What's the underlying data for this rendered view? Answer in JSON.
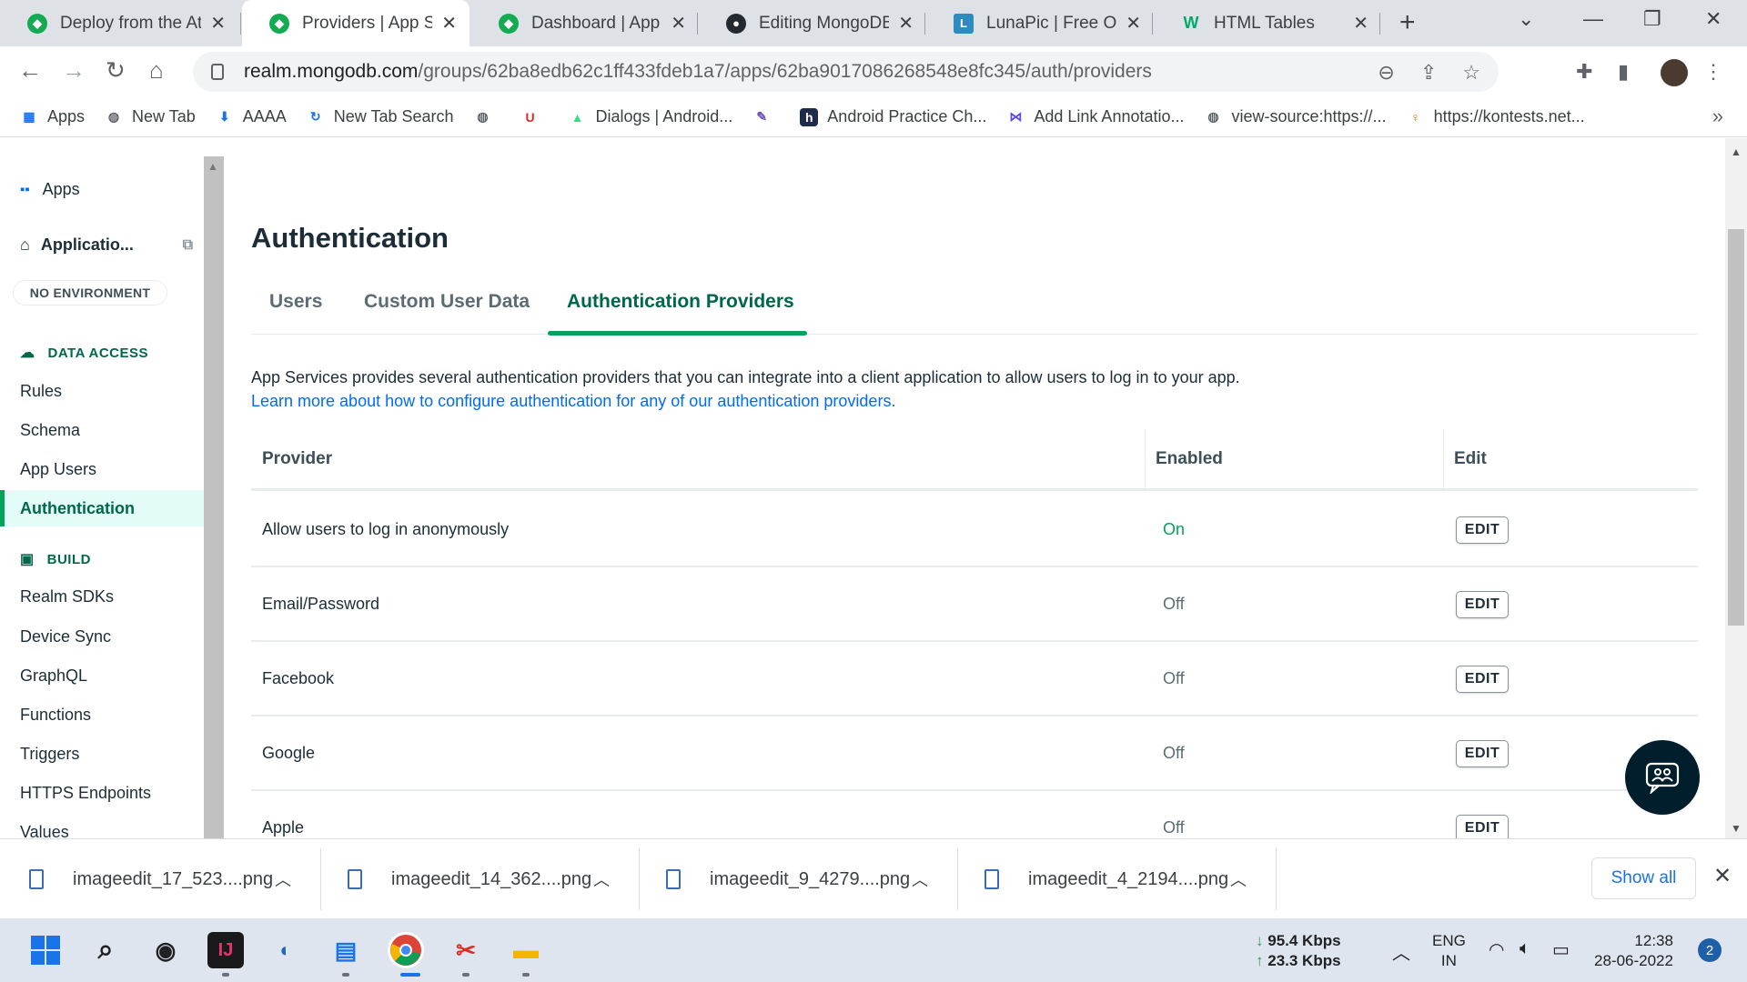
{
  "browser": {
    "tabs": [
      {
        "title": "Deploy from the At",
        "favicon": "mongodb-leaf-icon",
        "active": false
      },
      {
        "title": "Providers | App Ser",
        "favicon": "mongodb-leaf-icon",
        "active": true
      },
      {
        "title": "Dashboard | App S",
        "favicon": "mongodb-leaf-icon",
        "active": false
      },
      {
        "title": "Editing MongoDB-I",
        "favicon": "github-icon",
        "active": false
      },
      {
        "title": "LunaPic | Free Onlin",
        "favicon": "lunapic-icon",
        "active": false
      },
      {
        "title": "HTML Tables",
        "favicon": "w3schools-icon",
        "active": false
      }
    ],
    "url_host": "realm.mongodb.com",
    "url_path": "/groups/62ba8edb62c1ff433fdeb1a7/apps/62ba9017086268548e8fc345/auth/providers",
    "bookmarks": [
      "Apps",
      "New Tab",
      "AAAA",
      "New Tab Search",
      "",
      "",
      "Dialogs | Android...",
      "",
      "Android Practice Ch...",
      "Add Link Annotatio...",
      "view-source:https://...",
      "https://kontests.net..."
    ]
  },
  "sidebar": {
    "apps_label": "Apps",
    "app_name": "Applicatio...",
    "environment": "NO ENVIRONMENT",
    "data_access_heading": "DATA ACCESS",
    "data_access_items": [
      "Rules",
      "Schema",
      "App Users",
      "Authentication"
    ],
    "build_heading": "BUILD",
    "build_items": [
      "Realm SDKs",
      "Device Sync",
      "GraphQL",
      "Functions",
      "Triggers",
      "HTTPS Endpoints",
      "Values"
    ]
  },
  "main": {
    "title": "Authentication",
    "tabs": [
      "Users",
      "Custom User Data",
      "Authentication Providers"
    ],
    "active_tab": "Authentication Providers",
    "description": "App Services provides several authentication providers that you can integrate into a client application to allow users to log in to your app.",
    "learn_more": "Learn more about how to configure authentication for any of our authentication providers.",
    "table": {
      "headers": [
        "Provider",
        "Enabled",
        "Edit"
      ],
      "rows": [
        {
          "provider": "Allow users to log in anonymously",
          "enabled": "On",
          "edit": "EDIT"
        },
        {
          "provider": "Email/Password",
          "enabled": "Off",
          "edit": "EDIT"
        },
        {
          "provider": "Facebook",
          "enabled": "Off",
          "edit": "EDIT"
        },
        {
          "provider": "Google",
          "enabled": "Off",
          "edit": "EDIT"
        },
        {
          "provider": "Apple",
          "enabled": "Off",
          "edit": "EDIT"
        }
      ]
    }
  },
  "downloads": {
    "files": [
      "imageedit_17_523....png",
      "imageedit_14_362....png",
      "imageedit_9_4279....png",
      "imageedit_4_2194....png"
    ],
    "show_all": "Show all"
  },
  "taskbar": {
    "net_down": "95.4 Kbps",
    "net_up": "23.3 Kbps",
    "lang_top": "ENG",
    "lang_bottom": "IN",
    "time": "12:38",
    "date": "28-06-2022",
    "notifications": "2"
  },
  "colors": {
    "accent": "#00a35c",
    "accent_dark": "#00684a",
    "link": "#016bf8"
  }
}
